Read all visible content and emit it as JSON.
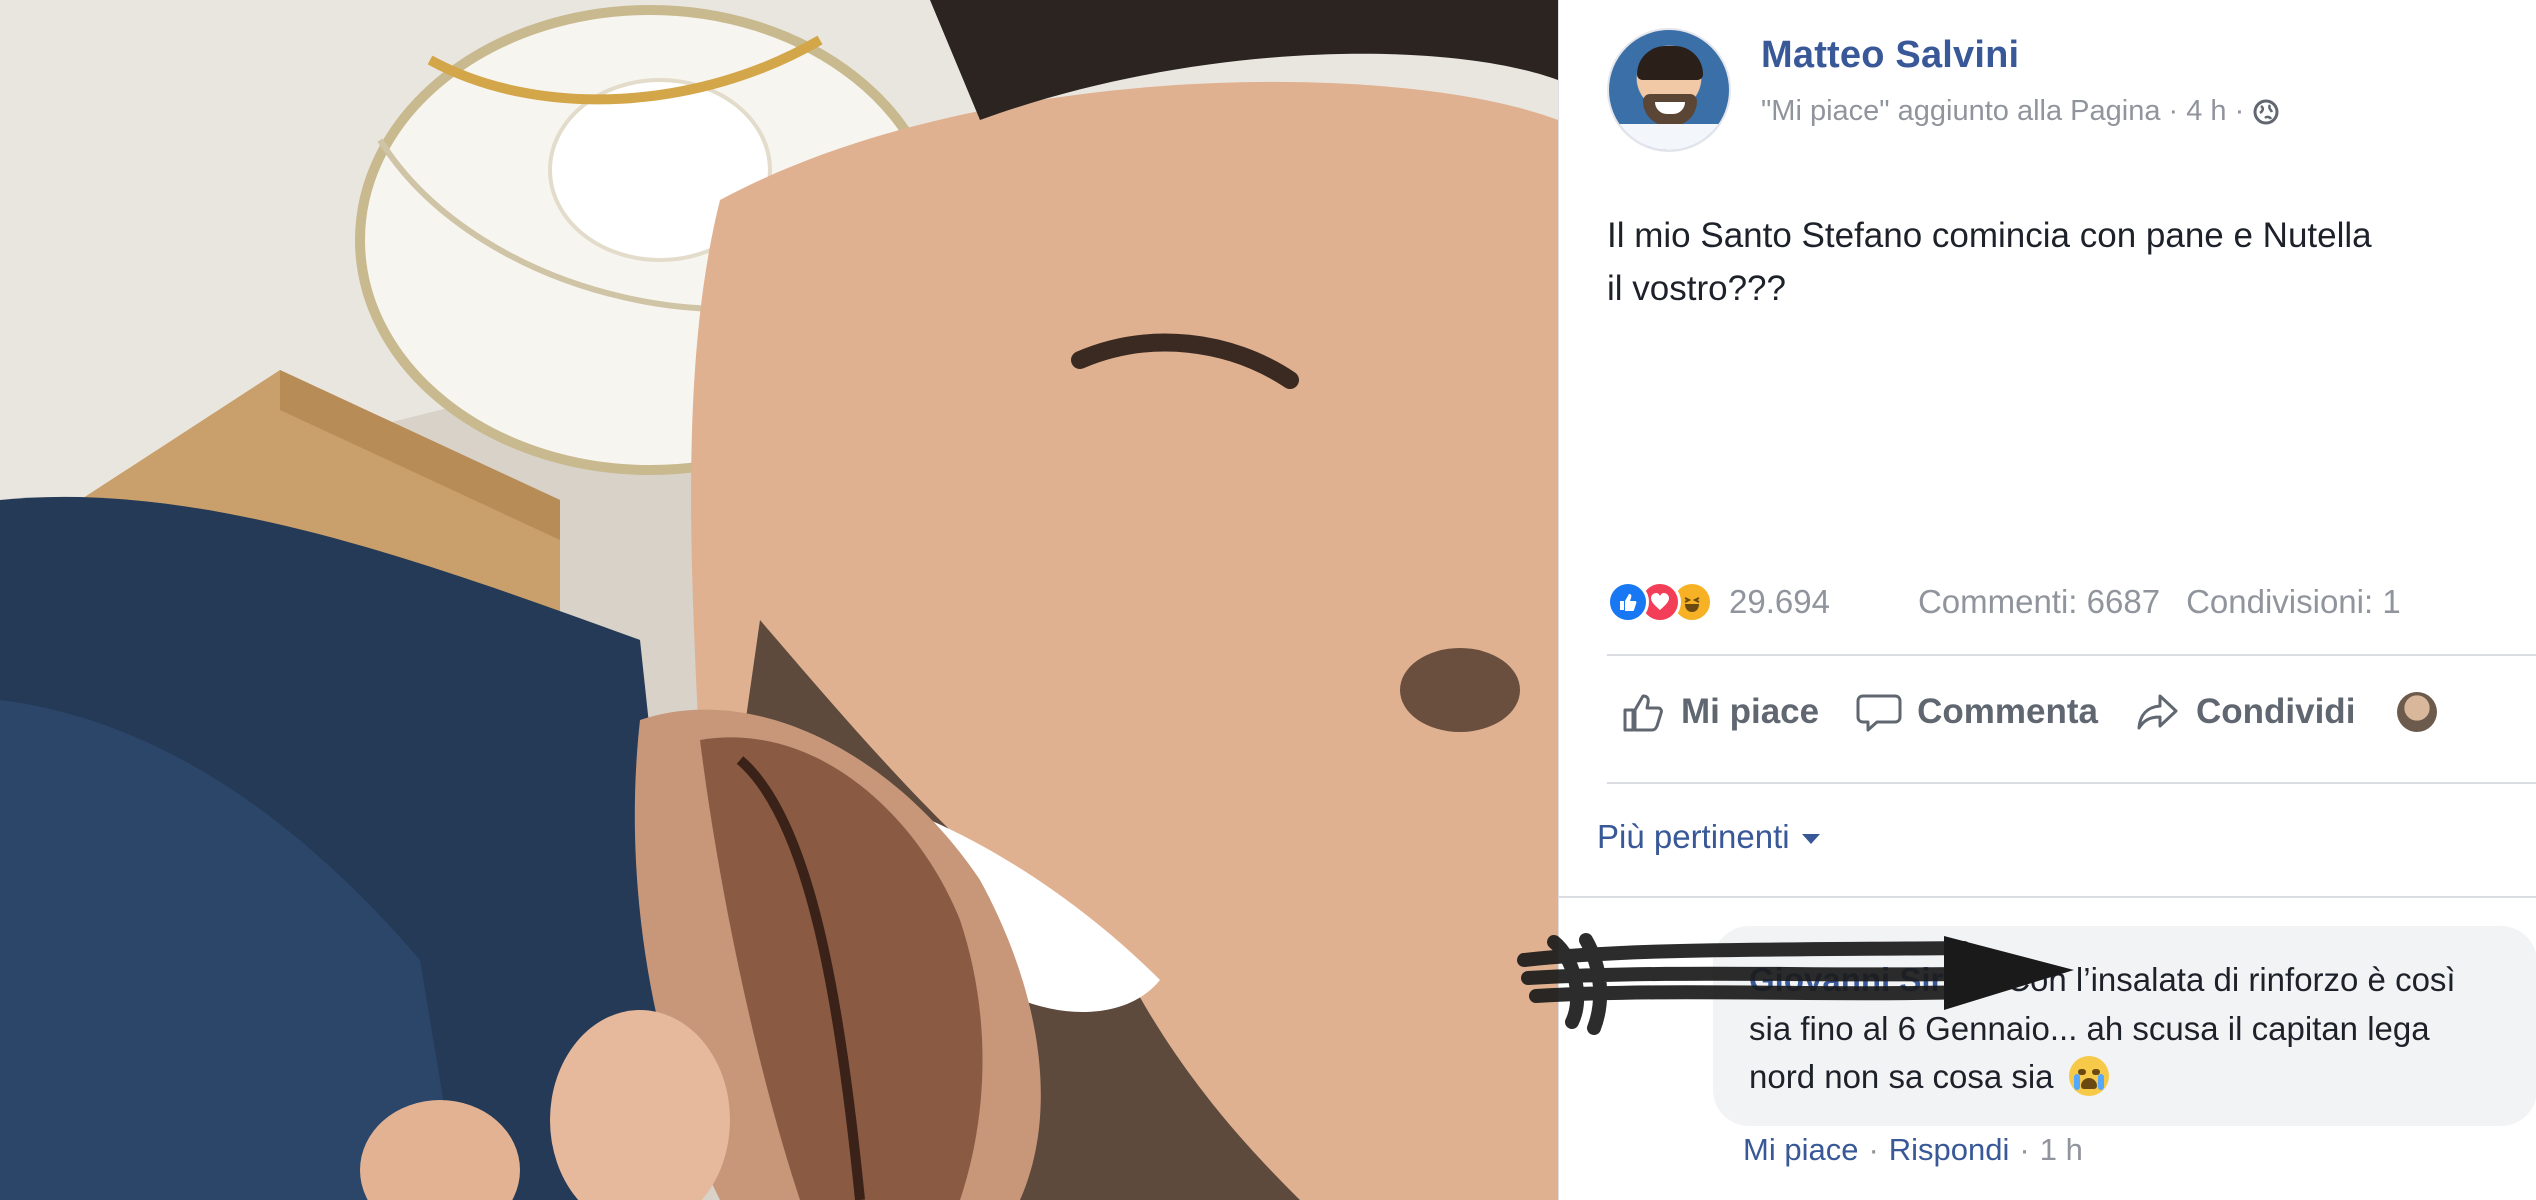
{
  "post": {
    "author": "Matteo Salvini",
    "subtitle": "\"Mi piace\" aggiunto alla Pagina · 4 h ·",
    "text": "Il mio Santo Stefano comincia con pane e Nutella\nil vostro???"
  },
  "stats": {
    "reactions_count": "29.694",
    "comments": "Commenti: 6687",
    "shares": "Condivisioni: 1"
  },
  "actions": {
    "like": "Mi piace",
    "comment": "Commenta",
    "share": "Condividi"
  },
  "comments_sort": "Più pertinenti",
  "comment": {
    "author": "Giovanni Sirolli",
    "text": "Con l’insalata di rinforzo è così sia fino al 6 Gennaio... ah scusa il capitan lega nord non sa cosa sia",
    "like": "Mi piace",
    "reply": "Rispondi",
    "time": "1 h"
  },
  "colors": {
    "link": "#385898",
    "meta_gray": "#90949c",
    "comment_bg": "#f2f3f5",
    "like_blue": "#1877f2",
    "love_red": "#f33e58",
    "haha_yellow": "#f7b125"
  },
  "icons": [
    "globe-icon",
    "like-reaction-icon",
    "love-reaction-icon",
    "haha-reaction-icon",
    "thumbs-up-icon",
    "comment-icon",
    "share-icon",
    "caret-down-icon",
    "crying-emoji-icon"
  ]
}
